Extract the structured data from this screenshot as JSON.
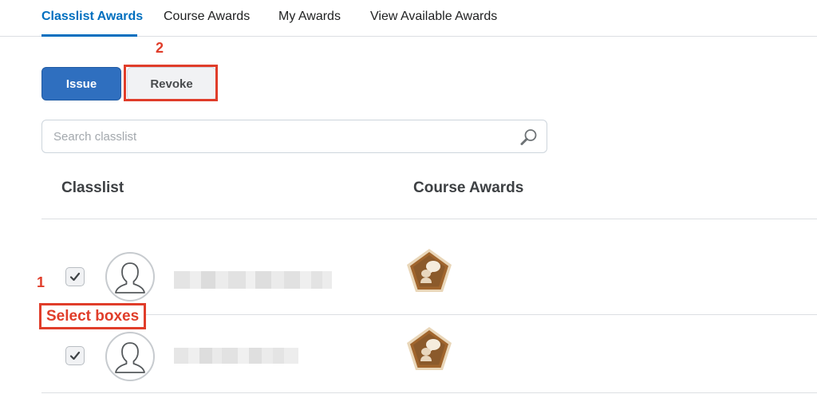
{
  "tabs": [
    {
      "label": "Classlist Awards",
      "active": true
    },
    {
      "label": "Course Awards",
      "active": false
    },
    {
      "label": "My Awards",
      "active": false
    },
    {
      "label": "View Available Awards",
      "active": false
    }
  ],
  "toolbar": {
    "issue_label": "Issue",
    "revoke_label": "Revoke"
  },
  "search": {
    "placeholder": "Search classlist",
    "value": ""
  },
  "table": {
    "columns": [
      "Classlist",
      "Course Awards"
    ],
    "rows": [
      {
        "checked": true,
        "name": "",
        "award_icon": "speech-bubble-award-badge"
      },
      {
        "checked": true,
        "name": "",
        "award_icon": "speech-bubble-award-badge"
      }
    ]
  },
  "annotations": {
    "step1_number": "1",
    "step1_label": "Select boxes",
    "step2_number": "2"
  },
  "colors": {
    "accent": "#006fbf",
    "primary_button": "#2f6fbf",
    "annotation": "#e03d2a",
    "badge": "#8b5a2b"
  }
}
